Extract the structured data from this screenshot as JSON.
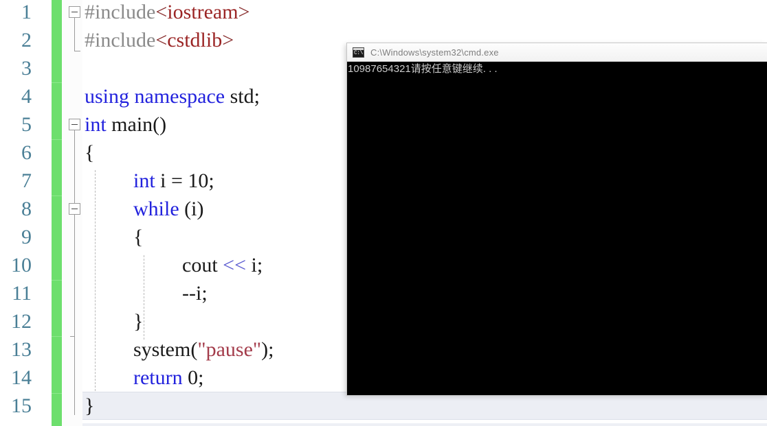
{
  "theme": {
    "editor_bg": "#ffffff",
    "line_number_color": "#4a7f96",
    "change_bar_color": "#6ddf6d",
    "keyword_color": "#2222dd",
    "preprocessor_color": "#8a8a8a",
    "include_name_color": "#9b2525",
    "string_color": "#a33b4a",
    "operator_color": "#5a5ad0",
    "current_line_bg": "#eceef4",
    "console_bg": "#000000",
    "console_text_color": "#cccccc",
    "console_titlebar_color": "#f2f2f2"
  },
  "editor": {
    "line_numbers": [
      "1",
      "2",
      "3",
      "4",
      "5",
      "6",
      "7",
      "8",
      "9",
      "10",
      "11",
      "12",
      "13",
      "14",
      "15"
    ],
    "current_line": 15,
    "lines": [
      {
        "n": "1",
        "indent": 0,
        "fold": "collapse-box",
        "tokens": [
          {
            "t": "#include",
            "c": "pre"
          },
          {
            "t": "<",
            "c": "angle"
          },
          {
            "t": "iostream",
            "c": "inc"
          },
          {
            "t": ">",
            "c": "angle"
          }
        ]
      },
      {
        "n": "2",
        "indent": 0,
        "fold": "end-bracket",
        "tokens": [
          {
            "t": "#include",
            "c": "pre"
          },
          {
            "t": "<",
            "c": "angle"
          },
          {
            "t": "cstdlib",
            "c": "inc"
          },
          {
            "t": ">",
            "c": "angle"
          }
        ]
      },
      {
        "n": "3",
        "indent": 0,
        "fold": "",
        "tokens": []
      },
      {
        "n": "4",
        "indent": 0,
        "fold": "",
        "tokens": [
          {
            "t": "using",
            "c": "kw"
          },
          {
            "t": " ",
            "c": "plain"
          },
          {
            "t": "namespace",
            "c": "kw"
          },
          {
            "t": " std;",
            "c": "plain"
          }
        ]
      },
      {
        "n": "5",
        "indent": 0,
        "fold": "collapse-box",
        "tokens": [
          {
            "t": "int",
            "c": "kw"
          },
          {
            "t": " main()",
            "c": "plain"
          }
        ]
      },
      {
        "n": "6",
        "indent": 0,
        "fold": "line",
        "tokens": [
          {
            "t": "{",
            "c": "plain"
          }
        ]
      },
      {
        "n": "7",
        "indent": 1,
        "fold": "line",
        "tokens": [
          {
            "t": "int",
            "c": "kw"
          },
          {
            "t": " i = 10;",
            "c": "plain"
          }
        ]
      },
      {
        "n": "8",
        "indent": 1,
        "fold": "collapse-box",
        "tokens": [
          {
            "t": "while",
            "c": "kw"
          },
          {
            "t": " (i)",
            "c": "plain"
          }
        ]
      },
      {
        "n": "9",
        "indent": 1,
        "fold": "line",
        "tokens": [
          {
            "t": "{",
            "c": "plain"
          }
        ]
      },
      {
        "n": "10",
        "indent": 2,
        "fold": "line",
        "tokens": [
          {
            "t": "cout ",
            "c": "plain"
          },
          {
            "t": "<<",
            "c": "op"
          },
          {
            "t": " i;",
            "c": "plain"
          }
        ]
      },
      {
        "n": "11",
        "indent": 2,
        "fold": "line",
        "tokens": [
          {
            "t": "--i;",
            "c": "plain"
          }
        ]
      },
      {
        "n": "12",
        "indent": 1,
        "fold": "line",
        "tokens": [
          {
            "t": "}",
            "c": "plain"
          }
        ]
      },
      {
        "n": "13",
        "indent": 1,
        "fold": "tick",
        "tokens": [
          {
            "t": "system(",
            "c": "plain"
          },
          {
            "t": "\"pause\"",
            "c": "str"
          },
          {
            "t": ");",
            "c": "plain"
          }
        ]
      },
      {
        "n": "14",
        "indent": 1,
        "fold": "line",
        "tokens": [
          {
            "t": "return",
            "c": "kw"
          },
          {
            "t": " 0;",
            "c": "plain"
          }
        ]
      },
      {
        "n": "15",
        "indent": 0,
        "fold": "line",
        "tokens": [
          {
            "t": "}",
            "c": "plain"
          }
        ]
      }
    ],
    "source_text": "#include<iostream>\n#include<cstdlib>\n\nusing namespace std;\nint main()\n{\n    int i = 10;\n    while (i)\n    {\n        cout << i;\n        --i;\n    }\n    system(\"pause\");\n    return 0;\n}"
  },
  "console": {
    "icon": "cmd-icon",
    "icon_prompt_glyph": "C:\\",
    "title": "C:\\Windows\\system32\\cmd.exe",
    "output_lines": [
      "10987654321请按任意键继续. . ."
    ],
    "output_text": "10987654321请按任意键继续. . ."
  }
}
